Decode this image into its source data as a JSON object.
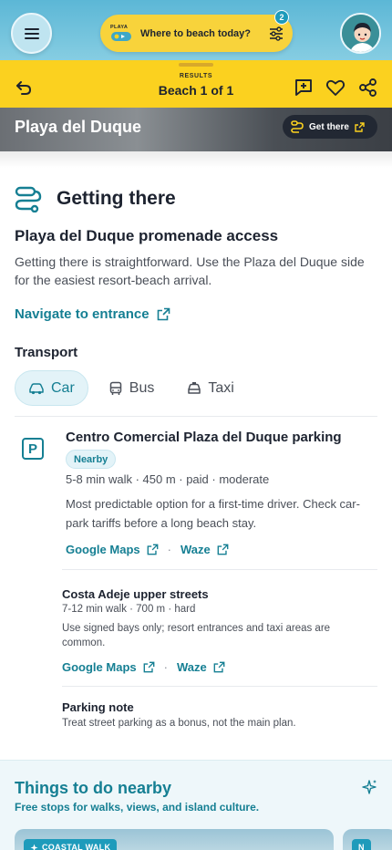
{
  "header": {
    "logo_text": "PLAYA",
    "search_label": "Where to beach today?",
    "filter_count": "2"
  },
  "results": {
    "label": "RESULTS",
    "title": "Beach 1 of 1"
  },
  "beach": {
    "name": "Playa del Duque",
    "get_there_label": "Get there"
  },
  "getting_there": {
    "title": "Getting there",
    "access_title": "Playa del Duque promenade access",
    "description": "Getting there is straightforward. Use the Plaza del Duque side for the easiest resort-beach arrival.",
    "navigate_label": "Navigate to entrance"
  },
  "transport": {
    "label": "Transport",
    "tabs": [
      {
        "label": "Car",
        "icon": "car-icon",
        "active": true
      },
      {
        "label": "Bus",
        "icon": "bus-icon",
        "active": false
      },
      {
        "label": "Taxi",
        "icon": "taxi-icon",
        "active": false
      }
    ]
  },
  "parking_main": {
    "title": "Centro Comercial Plaza del Duque parking",
    "badge": "Nearby",
    "meta": "5-8 min walk · 450 m · paid · moderate",
    "description": "Most predictable option for a first-time driver. Check car-park tariffs before a long beach stay.",
    "link1": "Google Maps",
    "separator": "·",
    "link2": "Waze"
  },
  "parking_alt": {
    "title": "Costa Adeje upper streets",
    "meta": "7-12 min walk · 700 m · hard",
    "description": "Use signed bays only; resort entrances and taxi areas are common.",
    "link1": "Google Maps",
    "separator": "·",
    "link2": "Waze"
  },
  "parking_note": {
    "title": "Parking note",
    "text": "Treat street parking as a bonus, not the main plan."
  },
  "things": {
    "title": "Things to do nearby",
    "subtitle": "Free stops for walks, views, and island culture.",
    "card_tag": "COASTAL WALK",
    "card2_tag": "N"
  },
  "colors": {
    "accent": "#157f93",
    "yellow": "#fbd11f",
    "sky": "#5cb7d6"
  }
}
